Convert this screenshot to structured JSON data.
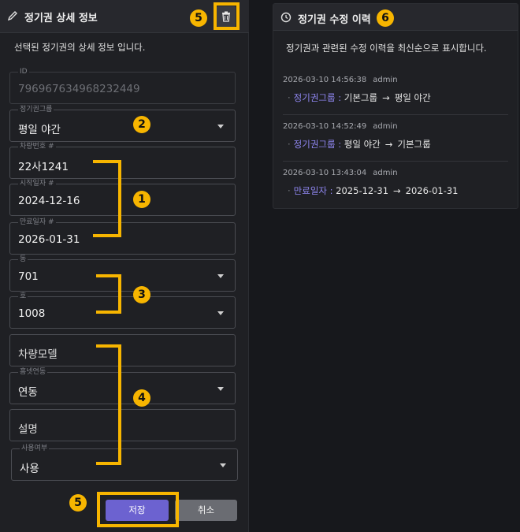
{
  "detail": {
    "title": "정기권 상세 정보",
    "description": "선택된 정기권의 상세 정보 입니다.",
    "fields": {
      "id": {
        "label": "ID",
        "value": "796967634968232449"
      },
      "group": {
        "label": "정기권그룹",
        "value": "평일 야간"
      },
      "car_number": {
        "label": "차량번호 #",
        "value": "22사1241"
      },
      "start_date": {
        "label": "시작일자 #",
        "value": "2024-12-16"
      },
      "end_date": {
        "label": "만료일자 #",
        "value": "2026-01-31"
      },
      "dong": {
        "label": "동",
        "value": "701"
      },
      "ho": {
        "label": "호",
        "value": "1008"
      },
      "car_model": {
        "placeholder": "차량모델"
      },
      "car_type": {
        "label": "홈넷연동",
        "value": "연동"
      },
      "memo": {
        "placeholder": "설명"
      },
      "use_yn": {
        "label": "사용여부",
        "value": "사용"
      }
    },
    "save_label": "저장",
    "cancel_label": "취소"
  },
  "history": {
    "title": "정기권 수정 이력",
    "description": "정기권과 관련된 수정 이력을 최신순으로 표시합니다.",
    "items": [
      {
        "timestamp": "2026-03-10 14:56:38",
        "user": "admin",
        "key": "정기권그룹 :",
        "from": "기본그룹",
        "to": "평일 야간"
      },
      {
        "timestamp": "2026-03-10 14:52:49",
        "user": "admin",
        "key": "정기권그룹 :",
        "from": "평일 야간",
        "to": "기본그룹"
      },
      {
        "timestamp": "2026-03-10 13:43:04",
        "user": "admin",
        "key": "만료일자 :",
        "from": "2025-12-31",
        "to": "2026-01-31"
      }
    ],
    "arrow": "→",
    "dot": "·"
  },
  "annotations": {
    "b1": "1",
    "b2": "2",
    "b3": "3",
    "b4": "4",
    "b5": "5",
    "b6": "6"
  },
  "colors": {
    "accent": "#6c62d0",
    "annotation": "#f7b500",
    "history_key": "#8f86f0"
  }
}
